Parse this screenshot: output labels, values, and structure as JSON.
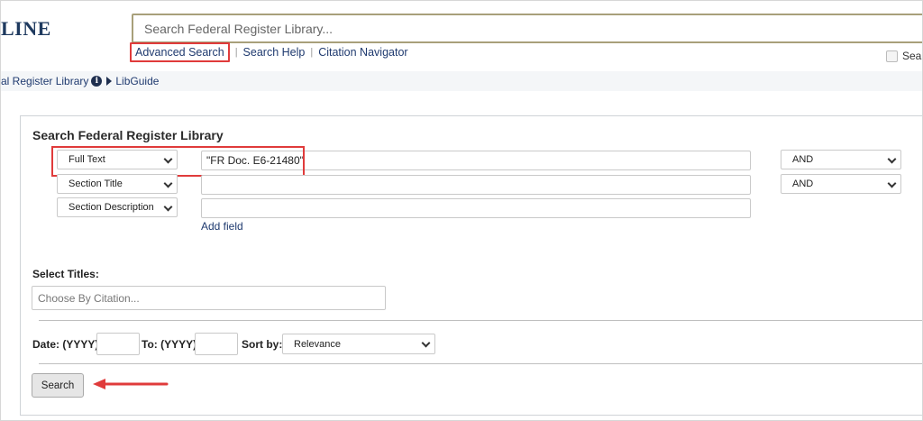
{
  "header": {
    "logo_text": "LINE",
    "search_placeholder": "Search Federal Register Library...",
    "links": {
      "advanced_search": "Advanced Search",
      "search_help": "Search Help",
      "citation_navigator": "Citation Navigator",
      "separator": "|"
    },
    "top_right_checkbox_label": "Sear"
  },
  "breadcrumb": {
    "library": "al Register Library",
    "libguide": "LibGuide"
  },
  "panel": {
    "title": "Search Federal Register Library",
    "rows": [
      {
        "field": "Full Text",
        "value": "\"FR Doc. E6-21480\"",
        "operator": "AND"
      },
      {
        "field": "Section Title",
        "value": "",
        "operator": "AND"
      },
      {
        "field": "Section Description",
        "value": ""
      }
    ],
    "add_field": "Add field",
    "select_titles_label": "Select Titles:",
    "citation_placeholder": "Choose By Citation...",
    "date_from_label": "Date: (YYYY)",
    "date_to_label": "To: (YYYY)",
    "sort_by_label": "Sort by:",
    "sort_value": "Relevance",
    "search_button": "Search"
  },
  "colors": {
    "highlight": "#e03b3b",
    "link": "#1f3a6f",
    "search_border": "#a8a07a"
  }
}
